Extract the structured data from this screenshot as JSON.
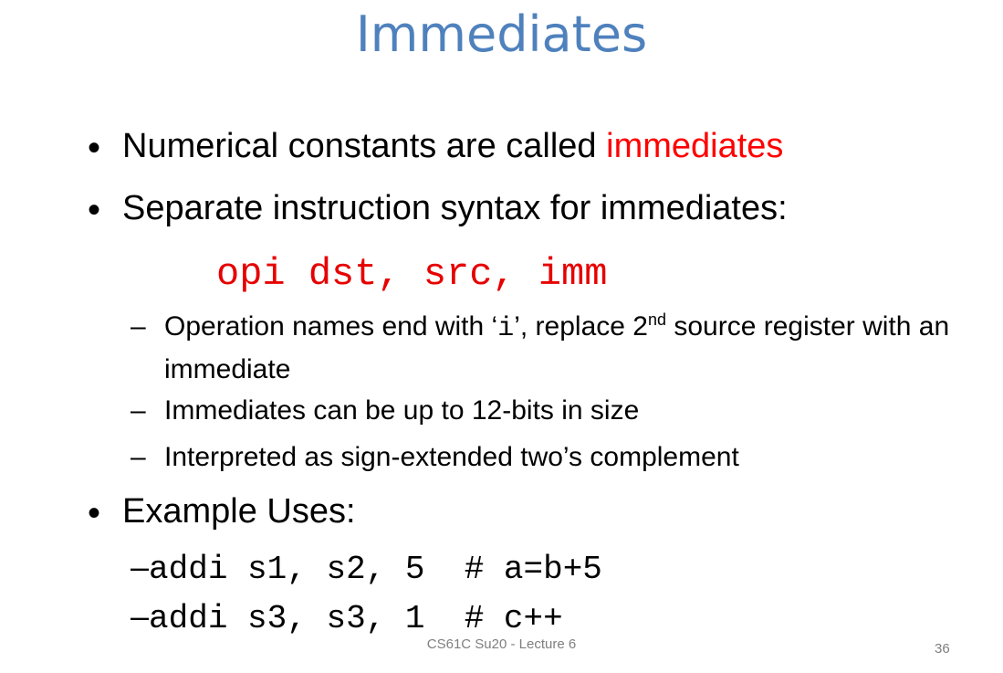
{
  "title": "Immediates",
  "bullets": [
    {
      "text": "Numerical constants are called ",
      "highlight": "immediates"
    },
    {
      "text": "Separate instruction syntax for immediates:"
    }
  ],
  "syntax": "opi dst, src, imm",
  "sub": [
    {
      "pre": "Operation names end with ‘",
      "mono": "i",
      "mid": "’, replace 2",
      "sup": "nd",
      "post": " source register with an immediate"
    },
    {
      "text": "Immediates can be up to 12-bits in size"
    },
    {
      "text": "Interpreted as sign-extended two’s complement"
    }
  ],
  "example": {
    "heading": "Example Uses:",
    "lines": [
      "addi s1, s2, 5  # a=b+5",
      "addi s3, s3, 1  # c++"
    ]
  },
  "footer": "CS61C Su20 - Lecture 6",
  "page_number": "36",
  "colors": {
    "title": "#4f81bd",
    "highlight": "#ff0000",
    "syntax": "#e60000"
  }
}
